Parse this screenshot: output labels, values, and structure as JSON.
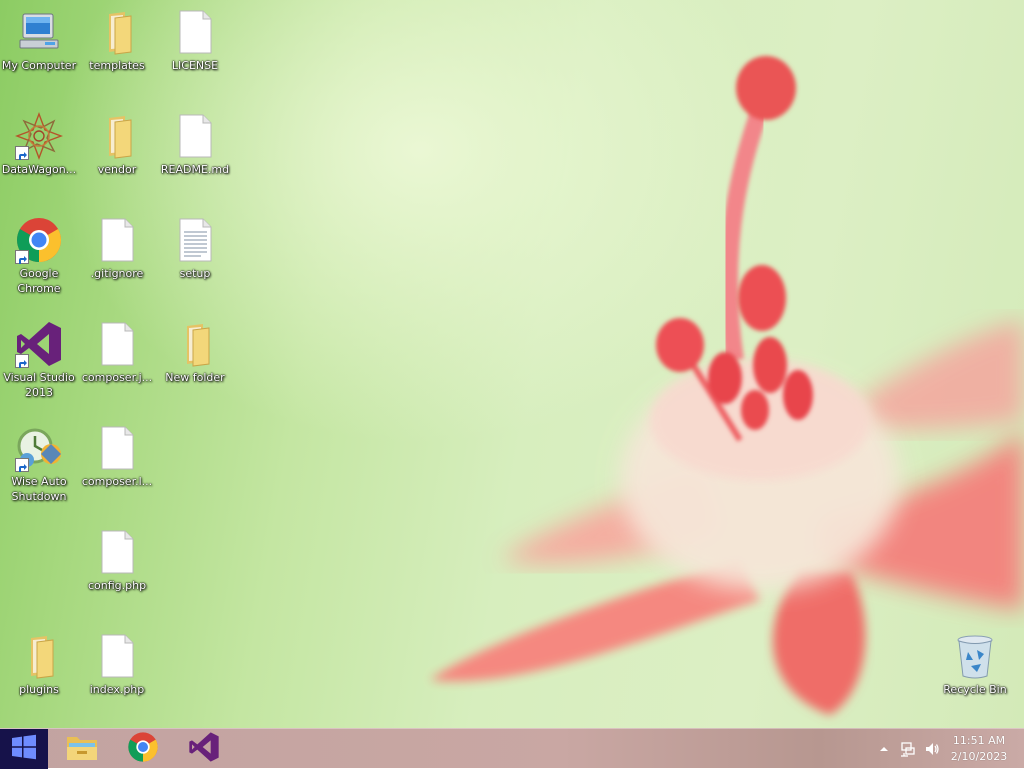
{
  "desktop": {
    "icons": [
      {
        "id": "my-computer",
        "label": "My Computer",
        "icon": "computer-icon"
      },
      {
        "id": "templates",
        "label": "templates",
        "icon": "folder-icon"
      },
      {
        "id": "license",
        "label": "LICENSE",
        "icon": "file-icon"
      },
      {
        "id": "datawagon",
        "label": "DataWagon...",
        "icon": "datawagon-icon"
      },
      {
        "id": "vendor",
        "label": "vendor",
        "icon": "folder-icon"
      },
      {
        "id": "readme",
        "label": "README.md",
        "icon": "file-icon"
      },
      {
        "id": "google-chrome",
        "label": "Google\nChrome",
        "icon": "chrome-icon"
      },
      {
        "id": "gitignore",
        "label": ".gitignore",
        "icon": "file-icon"
      },
      {
        "id": "setup",
        "label": "setup",
        "icon": "text-file-icon"
      },
      {
        "id": "visual-studio",
        "label": "Visual Studio\n2013",
        "icon": "visual-studio-icon"
      },
      {
        "id": "composer-json",
        "label": "composer.j...",
        "icon": "file-icon"
      },
      {
        "id": "new-folder",
        "label": "New folder",
        "icon": "folder-icon"
      },
      {
        "id": "wise-auto-shutdown",
        "label": "Wise Auto\nShutdown",
        "icon": "wise-shutdown-icon"
      },
      {
        "id": "composer-lock",
        "label": "composer.l...",
        "icon": "file-icon"
      },
      {
        "id": "config-php",
        "label": "config.php",
        "icon": "file-icon"
      },
      {
        "id": "plugins",
        "label": "plugins",
        "icon": "folder-icon"
      },
      {
        "id": "index-php",
        "label": "index.php",
        "icon": "file-icon"
      },
      {
        "id": "recycle-bin",
        "label": "Recycle Bin",
        "icon": "recycle-bin-icon"
      }
    ]
  },
  "taskbar": {
    "start_icon": "windows-logo-icon",
    "pinned": [
      {
        "id": "file-explorer",
        "icon": "file-explorer-icon"
      },
      {
        "id": "chrome",
        "icon": "chrome-icon"
      },
      {
        "id": "visual-studio",
        "icon": "visual-studio-icon"
      }
    ],
    "tray": {
      "icons": [
        "show-hidden-icons-icon",
        "network-icon",
        "volume-icon"
      ],
      "time": "11:51 AM",
      "date": "2/10/2023"
    }
  },
  "colors": {
    "start_button": "#16124a",
    "visual_studio_purple": "#68217a",
    "folder_yellow": "#f3d77a",
    "flower_pink": "#f06a6a"
  }
}
